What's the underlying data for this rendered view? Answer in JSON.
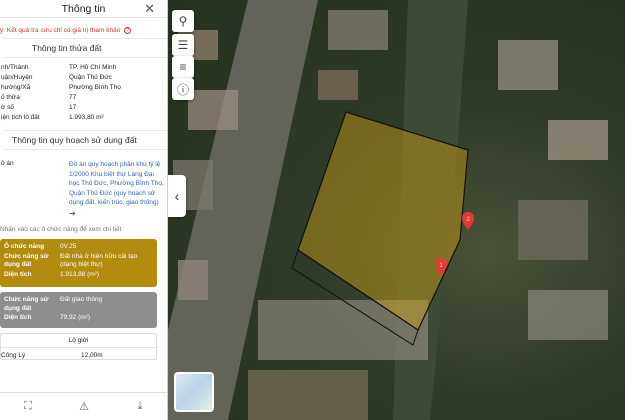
{
  "panel": {
    "title": "Thông tin",
    "close": "✕",
    "notice": "ý: Kết quả tra cứu chỉ có giá trị tham khảo",
    "notice_icon": "?",
    "parcel_title": "Thông tin thửa đất",
    "parcel": [
      {
        "k": "nh/Thành",
        "v": "TP. Hồ Chí Minh"
      },
      {
        "k": "uận/Huyện",
        "v": "Quận Thủ Đức"
      },
      {
        "k": "hường/Xã",
        "v": "Phường Bình Thọ"
      },
      {
        "k": "ố thửa",
        "v": "77"
      },
      {
        "k": "ờ số",
        "v": "17"
      },
      {
        "k": "iện tích lô đất",
        "v": "1.993,80 m²"
      }
    ],
    "planning_title": "Thông tin quy hoạch sử dụng đất",
    "plan_key": "ồ án",
    "plan_link": "Đồ án quy hoạch phân khu tỷ lệ 1/2000 Khu biệt thự Làng Đại học Thủ Đức, Phường Bình Thọ, Quận Thủ Đức (quy hoạch sử dụng đất, kiến trúc, giao thông)",
    "plan_arrow": "➔",
    "hint": "Nhấn vào các ô chức năng để xem chi tiết",
    "func1": {
      "k1": "Ô chức năng",
      "v1": "0V.25",
      "k2": "Chức năng sử dụng đất",
      "v2": "Đất nhà ở hiện hữu cải tạo (dạng biệt thự)",
      "k3": "Diện tích",
      "v3": "1.913,88 (m²)",
      "color": "#b28c0f"
    },
    "func2": {
      "k2": "Chức năng sử dụng đất",
      "v2": "Đất giao thông",
      "k3": "Diện tích",
      "v3": "79,92 (m²)",
      "color": "#8e8e8e"
    },
    "lo_gioi": {
      "head": "Lộ giới",
      "road": "Công Lý",
      "width": "12,00m"
    }
  },
  "map": {
    "controls": [
      "search-icon",
      "layers-icon",
      "list-icon",
      "info-icon"
    ],
    "pins": [
      "1",
      "2"
    ],
    "plot_color": "#c9a214"
  }
}
